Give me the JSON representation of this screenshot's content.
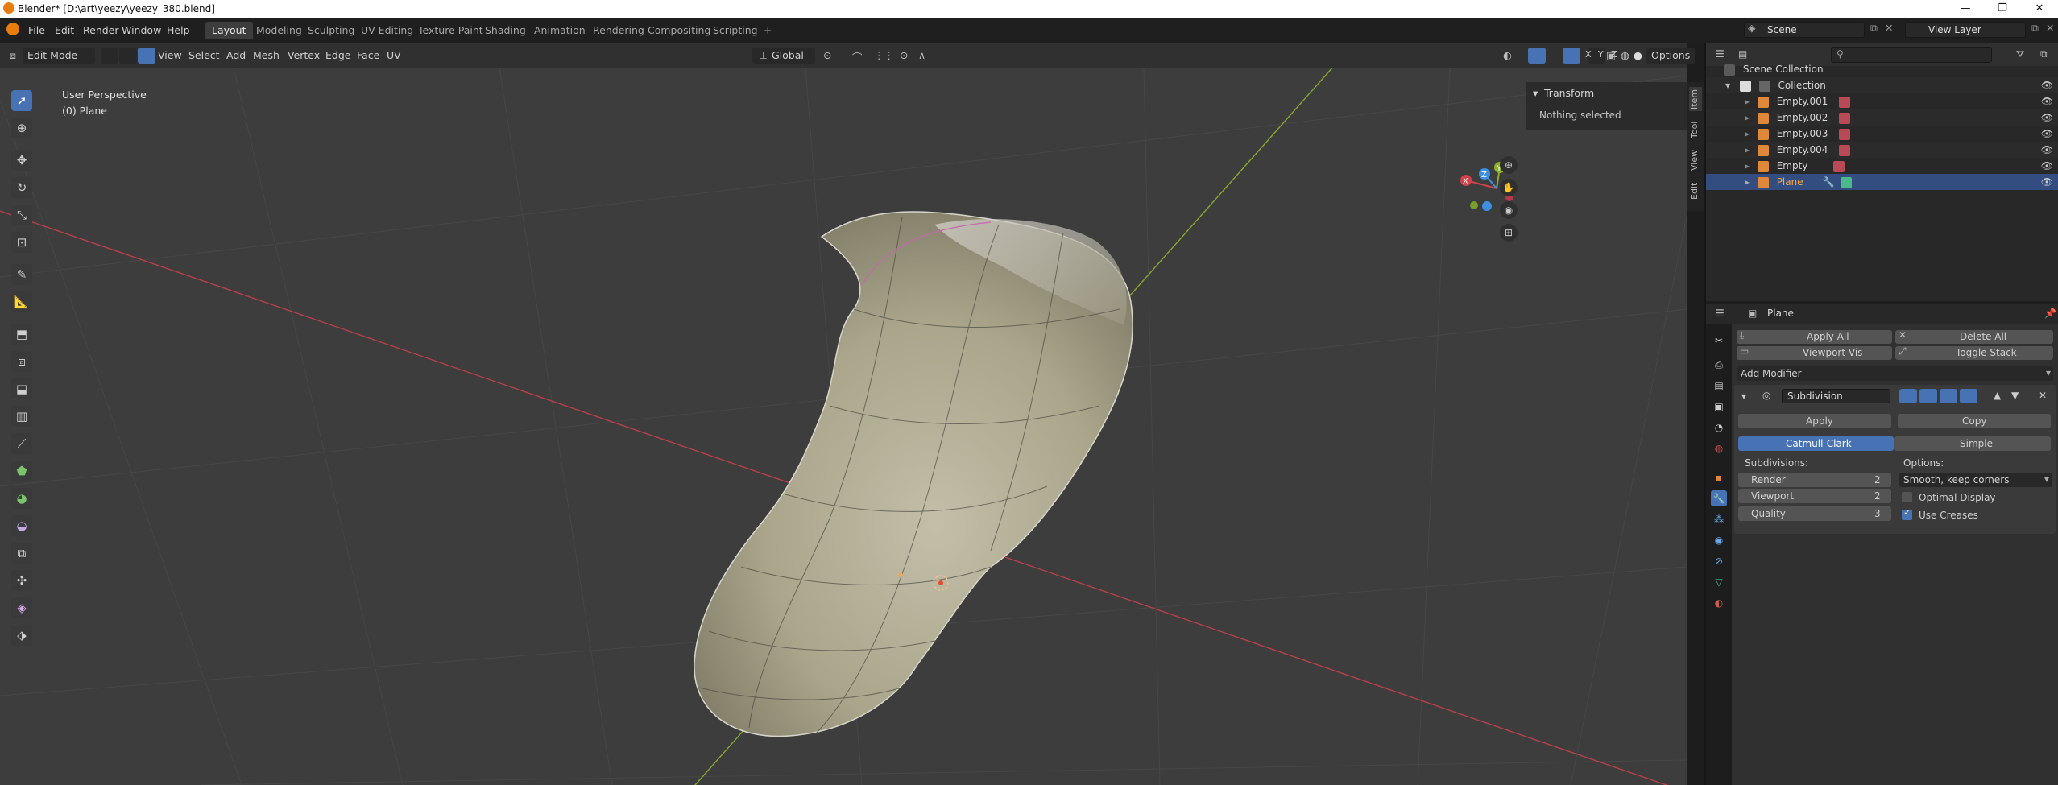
{
  "window": {
    "title": "Blender* [D:\\art\\yeezy\\yeezy_380.blend]",
    "min": "—",
    "max": "❐",
    "close": "✕"
  },
  "menus": [
    "File",
    "Edit",
    "Render",
    "Window",
    "Help"
  ],
  "workspaces": [
    "Layout",
    "Modeling",
    "Sculpting",
    "UV Editing",
    "Texture Paint",
    "Shading",
    "Animation",
    "Rendering",
    "Compositing",
    "Scripting"
  ],
  "add_workspace": "+",
  "scene": {
    "label": "Scene",
    "view_layer": "View Layer"
  },
  "header": {
    "mode": "Edit Mode",
    "menus": [
      "View",
      "Select",
      "Add",
      "Mesh",
      "Vertex",
      "Edge",
      "Face",
      "UV"
    ],
    "orientation": "Global",
    "axes": [
      "X",
      "Y",
      "Z"
    ],
    "options": "Options"
  },
  "viewport": {
    "perspective": "User Perspective",
    "object": "(0) Plane",
    "gizmo_x": "X",
    "gizmo_y": "Y",
    "gizmo_z": "Z"
  },
  "npanel": {
    "section": "Transform",
    "message": "Nothing selected",
    "tabs": [
      "Item",
      "Tool",
      "View",
      "Edit"
    ]
  },
  "outliner": {
    "root": "Scene Collection",
    "collection": "Collection",
    "items": [
      "Empty.001",
      "Empty.002",
      "Empty.003",
      "Empty.004",
      "Empty",
      "Plane"
    ],
    "selected": "Plane",
    "search_placeholder": ""
  },
  "properties": {
    "object": "Plane",
    "apply_all": "Apply All",
    "delete_all": "Delete All",
    "viewport_vis": "Viewport Vis",
    "toggle_stack": "Toggle Stack",
    "add_modifier": "Add Modifier",
    "modifier_name": "Subdivision",
    "apply": "Apply",
    "copy": "Copy",
    "catmull": "Catmull-Clark",
    "simple": "Simple",
    "subdivisions_label": "Subdivisions:",
    "options_label": "Options:",
    "render_label": "Render",
    "render_value": "2",
    "viewport_label": "Viewport",
    "viewport_value": "2",
    "quality_label": "Quality",
    "quality_value": "3",
    "uv_smooth": "Smooth, keep corners",
    "optimal_display": "Optimal Display",
    "use_creases": "Use Creases",
    "optimal_checked": false,
    "creases_checked": true
  },
  "colors": {
    "accent": "#4772b3",
    "x_axis": "#d04348",
    "y_axis": "#8ab12a",
    "selected_text": "#ffa63c"
  }
}
